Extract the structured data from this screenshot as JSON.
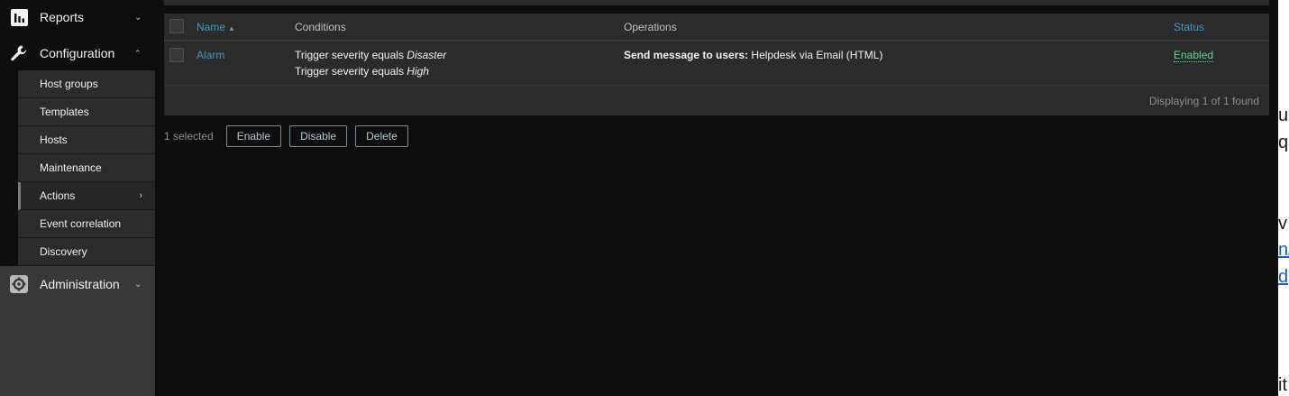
{
  "sidebar": {
    "reports_label": "Reports",
    "configuration_label": "Configuration",
    "administration_label": "Administration",
    "config_items": [
      {
        "label": "Host groups"
      },
      {
        "label": "Templates"
      },
      {
        "label": "Hosts"
      },
      {
        "label": "Maintenance"
      },
      {
        "label": "Actions"
      },
      {
        "label": "Event correlation"
      },
      {
        "label": "Discovery"
      }
    ]
  },
  "table": {
    "headers": {
      "name": "Name",
      "conditions": "Conditions",
      "operations": "Operations",
      "status": "Status"
    },
    "rows": [
      {
        "name": "Alarm",
        "conditions": [
          {
            "text": "Trigger severity equals ",
            "value": "Disaster"
          },
          {
            "text": "Trigger severity equals ",
            "value": "High"
          }
        ],
        "operation_bold": "Send message to users:",
        "operation_rest": " Helpdesk via Email (HTML)",
        "status": "Enabled"
      }
    ],
    "footer": "Displaying 1 of 1 found"
  },
  "mass_actions": {
    "selected_text": "1 selected",
    "enable_label": "Enable",
    "disable_label": "Disable",
    "delete_label": "Delete"
  },
  "right_window": {
    "fragments": [
      "ur",
      "q",
      "v",
      "n/",
      "d",
      "it"
    ]
  },
  "colors": {
    "link": "#4796c4",
    "enabled": "#59db8f",
    "sidebar_bg": "#383838",
    "page_bg": "#0e0e0e",
    "table_bg": "#2b2b2b"
  }
}
